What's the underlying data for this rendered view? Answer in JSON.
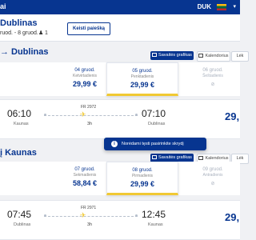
{
  "topbar": {
    "brand": "ai",
    "currency": "DUK"
  },
  "trip": {
    "title": "Dublinas",
    "dates": "ruod. - 8 gruod.",
    "pax": "1",
    "edit_label": "Keisti paiešką"
  },
  "outbound": {
    "title": "Dublinas",
    "arrow": "→",
    "view_buttons": [
      {
        "label": "Savaitės grafikas",
        "active": true
      },
      {
        "label": "Kalendorius",
        "active": false
      },
      {
        "label": "Lėk",
        "active": false
      }
    ],
    "dates": [
      {
        "date": "04 gruod.",
        "weekday": "Ketvirtadienis",
        "price": "29,99 €",
        "state": "normal"
      },
      {
        "date": "05 gruod.",
        "weekday": "Penktadienis",
        "price": "29,99 €",
        "state": "selected"
      },
      {
        "date": "06 gruod.",
        "weekday": "Šeštadienis",
        "price": "",
        "state": "disabled"
      }
    ],
    "flight": {
      "dep_time": "06:10",
      "dep_city": "Kaunas",
      "flight_no": "FR 2972",
      "duration": "3h",
      "arr_time": "07:10",
      "arr_city": "Dublinas",
      "price": "29,"
    }
  },
  "toast": {
    "message": "Norėdami tęsti pasirinkite skrydį"
  },
  "inbound": {
    "title": "į Kaunas",
    "view_buttons": [
      {
        "label": "Savaitės grafikas",
        "active": true
      },
      {
        "label": "Kalendorius",
        "active": false
      },
      {
        "label": "Lėk",
        "active": false
      }
    ],
    "dates": [
      {
        "date": "07 gruod.",
        "weekday": "Sekmadienis",
        "price": "58,84 €",
        "state": "normal"
      },
      {
        "date": "08 gruod.",
        "weekday": "Pirmadienis",
        "price": "29,99 €",
        "state": "selected"
      },
      {
        "date": "09 gruod.",
        "weekday": "Antradienis",
        "price": "",
        "state": "disabled"
      }
    ],
    "flight": {
      "dep_time": "07:45",
      "dep_city": "Dublinas",
      "flight_no": "FR 2971",
      "duration": "3h",
      "arr_time": "12:45",
      "arr_city": "Kaunas",
      "price": "29,"
    }
  },
  "icons": {
    "plane": "plane-icon",
    "info": "info-icon",
    "person": "person-icon"
  },
  "colors": {
    "brand": "#073590",
    "accent": "#f1c933"
  }
}
